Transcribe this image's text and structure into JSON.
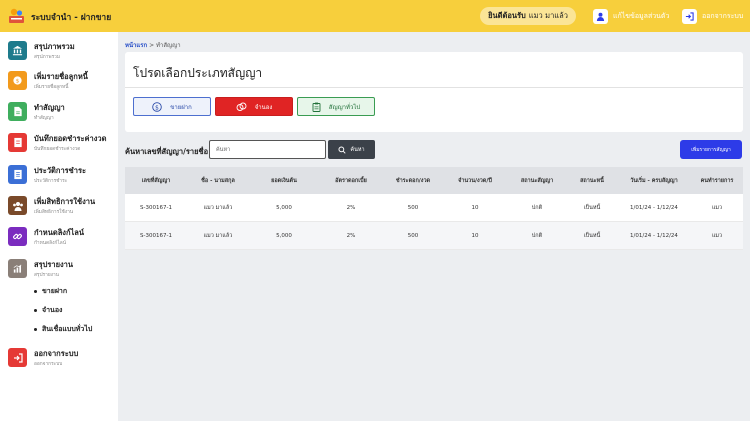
{
  "header": {
    "app_title": "ระบบจำนำ - ฝากขาย",
    "welcome_prefix": "ยินดีต้อนรับ",
    "welcome_user": "แมว มาแล้ว",
    "edit_profile": "แก้ไขข้อมูลส่วนตัว",
    "logout": "ออกจากระบบ"
  },
  "sidebar": {
    "items": [
      {
        "label": "สรุปภาพรวม",
        "sub": "สรุปภาพรวม",
        "icon": "bank-icon",
        "color": "#1e7b8c"
      },
      {
        "label": "เพิ่มรายชื่อลูกหนี้",
        "sub": "เพิ่มรายชื่อลูกหนี้",
        "icon": "coin-icon",
        "color": "#f29a1c"
      },
      {
        "label": "ทำสัญญา",
        "sub": "ทำสัญญา",
        "icon": "document-icon",
        "color": "#3fae5e"
      },
      {
        "label": "บันทึกยอดชำระค่างวด",
        "sub": "บันทึกยอดชำระค่างวด",
        "icon": "payment-icon",
        "color": "#e53935"
      },
      {
        "label": "ประวัติการชำระ",
        "sub": "ประวัติการชำระ",
        "icon": "history-icon",
        "color": "#3b6fd6"
      },
      {
        "label": "เพิ่มสิทธิการใช้งาน",
        "sub": "เพิ่มสิทธิการใช้งาน",
        "icon": "users-icon",
        "color": "#7a4a2a"
      },
      {
        "label": "กำหนดลิงก์ไลน์",
        "sub": "กำหนดลิงก์ไลน์",
        "icon": "link-icon",
        "color": "#7b2cbf"
      },
      {
        "label": "สรุปรายงาน",
        "sub": "สรุปรายงาน",
        "icon": "chart-icon",
        "color": "#8a7f78"
      }
    ],
    "sub_items": [
      "ขายฝาก",
      "จำนอง",
      "สินเชื่อแบบทั่วไป"
    ],
    "logout": {
      "label": "ออกจากระบบ",
      "sub": "ออกจากระบบ",
      "icon": "logout-icon",
      "color": "#e53935"
    }
  },
  "breadcrumb": {
    "home": "หน้าแรก",
    "separator": ">",
    "current": "ทำสัญญา"
  },
  "card": {
    "title": "โปรดเลือกประเภทสัญญา",
    "buttons": {
      "consign": "ขายฝาก",
      "pawn": "จำนอง",
      "general": "สัญญาทั่วไป"
    }
  },
  "search": {
    "label": "ค้นหาเลขที่สัญญา/รายชื่อ",
    "placeholder": "ค้นหา",
    "button": "ค้นหา",
    "add_button": "เพิ่มรายการสัญญา"
  },
  "table": {
    "columns": [
      "เลขที่สัญญา",
      "ชื่อ - นามสกุล",
      "ยอดเงินต้น",
      "อัตราดอกเบี้ย",
      "ชำระดอก/งวด",
      "จำนวน/งวด/ปี",
      "สถานะสัญญา",
      "สถานะหนี้",
      "วันเริ่ม - ครบสัญญา",
      "คนทำรายการ"
    ],
    "rows": [
      [
        "S-300167-1",
        "แมว มาแล้ว",
        "5,000",
        "2%",
        "500",
        "10",
        "ปกติ",
        "เป็นหนี้",
        "1/01/24 - 1/12/24",
        "แมว"
      ],
      [
        "S-300167-1",
        "แมว มาแล้ว",
        "5,000",
        "2%",
        "500",
        "10",
        "ปกติ",
        "เป็นหนี้",
        "1/01/24 - 1/12/24",
        "แมว"
      ]
    ]
  }
}
